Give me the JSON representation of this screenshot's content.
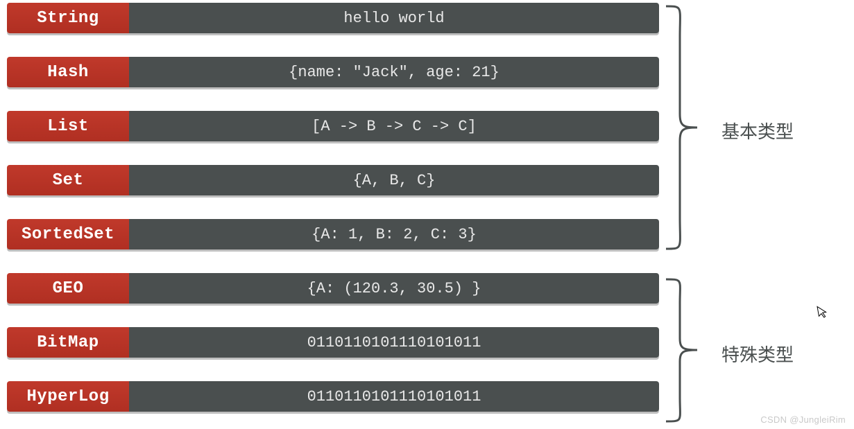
{
  "groups": [
    {
      "label": "基本类型",
      "rows": [
        {
          "type": "String",
          "value": "hello world"
        },
        {
          "type": "Hash",
          "value": "{name: \"Jack\", age: 21}"
        },
        {
          "type": "List",
          "value": "[A -> B -> C -> C]"
        },
        {
          "type": "Set",
          "value": "{A, B, C}"
        },
        {
          "type": "SortedSet",
          "value": "{A: 1, B: 2, C: 3}"
        }
      ]
    },
    {
      "label": "特殊类型",
      "rows": [
        {
          "type": "GEO",
          "value": "{A: (120.3,  30.5) }"
        },
        {
          "type": "BitMap",
          "value": "0110110101110101011"
        },
        {
          "type": "HyperLog",
          "value": "0110110101110101011"
        }
      ]
    }
  ],
  "watermark": "CSDN @JungleiRim",
  "colors": {
    "type_bg": "#c0392b",
    "value_bg": "#4a4f4f",
    "text_light": "#ffffff",
    "text_value": "#e8e8e8",
    "label": "#4a4f4f"
  }
}
